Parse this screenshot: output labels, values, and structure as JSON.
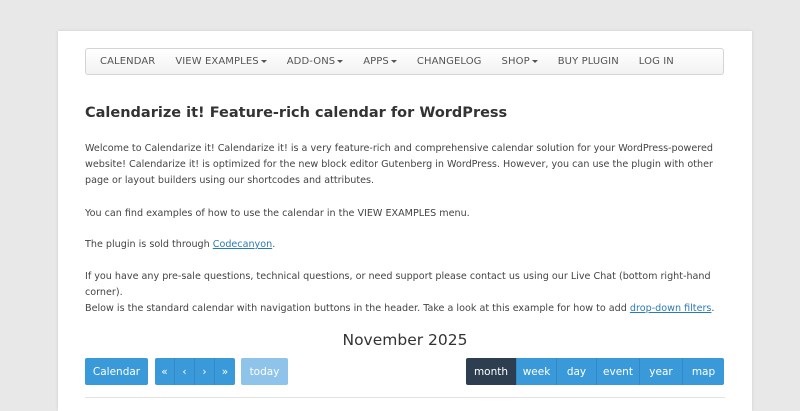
{
  "nav": {
    "items": [
      {
        "label": "CALENDAR",
        "dropdown": false
      },
      {
        "label": "VIEW EXAMPLES",
        "dropdown": true
      },
      {
        "label": "ADD-ONS",
        "dropdown": true
      },
      {
        "label": "APPS",
        "dropdown": true
      },
      {
        "label": "CHANGELOG",
        "dropdown": false
      },
      {
        "label": "SHOP",
        "dropdown": true
      },
      {
        "label": "BUY PLUGIN",
        "dropdown": false
      },
      {
        "label": "LOG IN",
        "dropdown": false
      }
    ]
  },
  "content": {
    "title": "Calendarize it! Feature-rich calendar for WordPress",
    "intro": "Welcome to Calendarize it! Calendarize it! is a very feature-rich and comprehensive calendar solution for your WordPress-powered website! Calendarize it! is optimized for the new block editor Gutenberg in WordPress. However, you can use the plugin with other page or layout builders using our shortcodes and attributes.",
    "examples_text": "You can find examples of how to use the calendar in the VIEW EXAMPLES menu.",
    "sold_prefix": "The plugin is sold through ",
    "sold_link": "Codecanyon",
    "sold_suffix": ".",
    "support_text": "If you have any pre-sale questions, technical questions, or need support please contact us using our Live Chat (bottom right-hand corner).",
    "below_prefix": "Below is the standard calendar with navigation buttons in the header. Take a look at this example for how to add ",
    "below_link": "drop-down filters",
    "below_suffix": "."
  },
  "calendar": {
    "month_title": "November 2025",
    "calendar_button": "Calendar",
    "nav_buttons": [
      "«",
      "‹",
      "›",
      "»"
    ],
    "today_button": "today",
    "views": [
      {
        "label": "month",
        "active": true
      },
      {
        "label": "week",
        "active": false
      },
      {
        "label": "day",
        "active": false
      },
      {
        "label": "event",
        "active": false
      },
      {
        "label": "year",
        "active": false
      },
      {
        "label": "map",
        "active": false
      }
    ]
  },
  "colors": {
    "primary": "#3a9ad9",
    "primary_light": "#8ec3ea",
    "active": "#2c3e50",
    "link": "#2a7ab8"
  }
}
